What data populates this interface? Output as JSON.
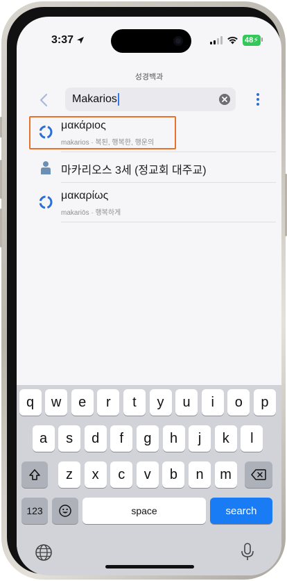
{
  "status": {
    "time": "3:37",
    "battery": "48"
  },
  "app_title": "성경백과",
  "search": {
    "value": "Makarios"
  },
  "results": [
    {
      "title": "μακάριος",
      "subtitle": "makarios · 복된, 행복한, 행운의",
      "icon": "lexicon-icon"
    },
    {
      "title": "마카리오스 3세 (정교회 대주교)",
      "subtitle": "",
      "icon": "person-icon"
    },
    {
      "title": "μακαρίως",
      "subtitle": "makariōs · 행복하게",
      "icon": "lexicon-icon"
    }
  ],
  "keyboard": {
    "row1": [
      "q",
      "w",
      "e",
      "r",
      "t",
      "y",
      "u",
      "i",
      "o",
      "p"
    ],
    "row2": [
      "a",
      "s",
      "d",
      "f",
      "g",
      "h",
      "j",
      "k",
      "l"
    ],
    "row3": [
      "z",
      "x",
      "c",
      "v",
      "b",
      "n",
      "m"
    ],
    "numbers_label": "123",
    "space_label": "space",
    "search_label": "search"
  },
  "colors": {
    "accent": "#1a7cf5",
    "highlight": "#e8722a",
    "lexicon_icon": "#2b6fd6"
  }
}
